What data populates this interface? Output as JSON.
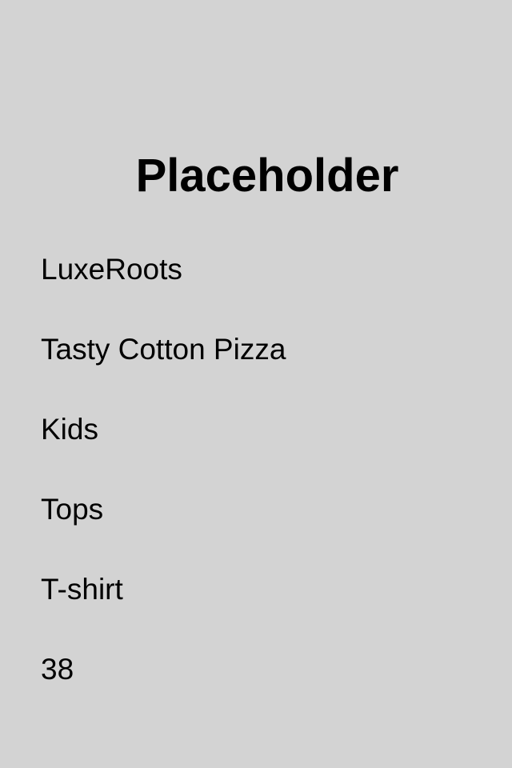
{
  "header": {
    "title": "Placeholder"
  },
  "product": {
    "brand": "LuxeRoots",
    "name": "Tasty Cotton Pizza",
    "audience": "Kids",
    "category": "Tops",
    "type": "T-shirt",
    "size": "38"
  }
}
